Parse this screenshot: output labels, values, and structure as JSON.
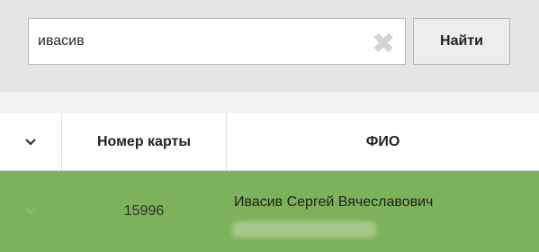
{
  "search": {
    "value": "ивасив",
    "clear_icon": "close-icon",
    "button_label": "Найти"
  },
  "table": {
    "columns": [
      {
        "label": "",
        "icon": "chevron-down-icon"
      },
      {
        "label": "Номер карты"
      },
      {
        "label": "ФИО"
      }
    ],
    "rows": [
      {
        "card_number": "15996",
        "fio": "Ивасив Сергей Вячеславович",
        "selected": true
      }
    ]
  },
  "colors": {
    "search_background": "#e5e5e5",
    "selected_row": "#7cb25a",
    "header_background": "#ffffff"
  }
}
